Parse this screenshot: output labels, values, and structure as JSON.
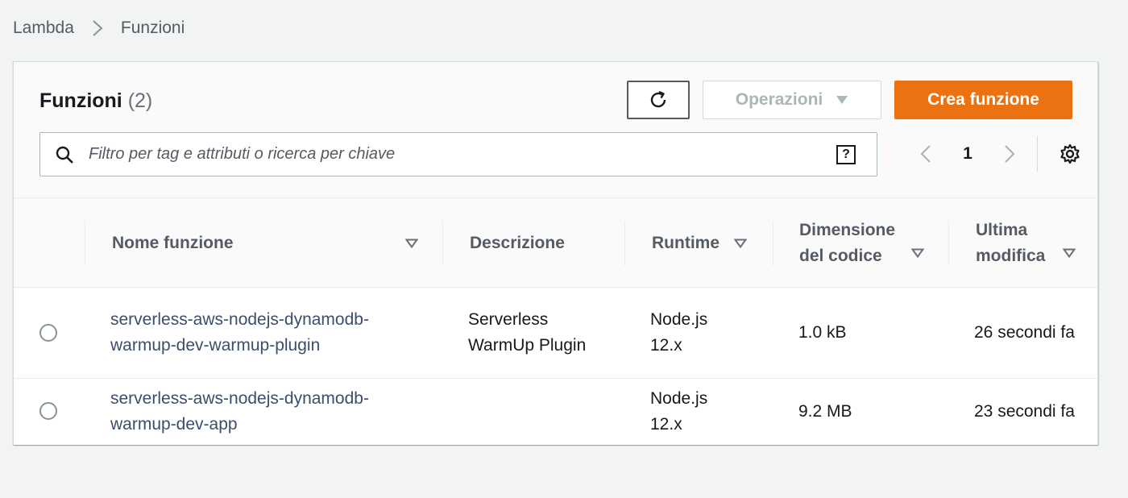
{
  "breadcrumb": {
    "items": [
      "Lambda",
      "Funzioni"
    ],
    "separator_icon": "chevron-right-icon"
  },
  "header": {
    "title": "Funzioni",
    "count": "(2)",
    "refresh_icon": "refresh-icon",
    "actions_label": "Operazioni",
    "create_label": "Crea funzione"
  },
  "search": {
    "placeholder": "Filtro per tag e attributi o ricerca per chiave",
    "value": "",
    "help_label": "?"
  },
  "pagination": {
    "current_page": "1",
    "prev_icon": "chevron-left-icon",
    "next_icon": "chevron-right-icon",
    "settings_icon": "gear-icon"
  },
  "table": {
    "columns": [
      {
        "label": "Nome funzione",
        "sortable": true
      },
      {
        "label": "Descrizione",
        "sortable": false
      },
      {
        "label": "Runtime",
        "sortable": true
      },
      {
        "label": "Dimensione del codice",
        "sortable": true
      },
      {
        "label": "Ultima modifica",
        "sortable": true
      }
    ],
    "rows": [
      {
        "name": "serverless-aws-nodejs-dynamodb-warmup-dev-warmup-plugin",
        "description": "Serverless WarmUp Plugin",
        "runtime": "Node.js 12.x",
        "code_size": "1.0 kB",
        "last_modified": "26 secondi fa"
      },
      {
        "name": "serverless-aws-nodejs-dynamodb-warmup-dev-app",
        "description": "",
        "runtime": "Node.js 12.x",
        "code_size": "9.2 MB",
        "last_modified": "23 secondi fa"
      }
    ]
  },
  "colors": {
    "primary_button": "#ec7211",
    "link_text": "#3b4e6b",
    "background": "#f2f3f3"
  }
}
